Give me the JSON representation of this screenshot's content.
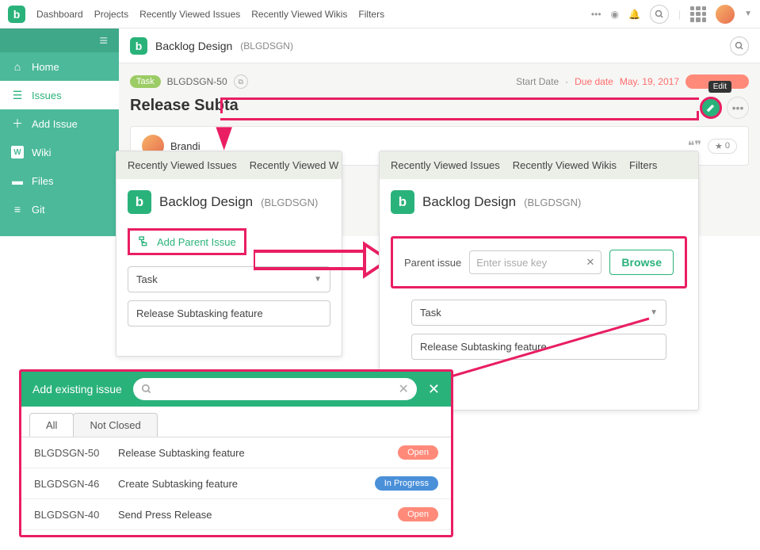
{
  "topnav": {
    "items": [
      "Dashboard",
      "Projects",
      "Recently Viewed Issues",
      "Recently Viewed Wikis",
      "Filters"
    ]
  },
  "sidebar": {
    "items": [
      {
        "label": "Home"
      },
      {
        "label": "Issues"
      },
      {
        "label": "Add Issue"
      },
      {
        "label": "Wiki"
      },
      {
        "label": "Files"
      },
      {
        "label": "Git"
      }
    ]
  },
  "project": {
    "name": "Backlog Design",
    "key": "(BLGDSGN)"
  },
  "issue": {
    "type_label": "Task",
    "key": "BLGDSGN-50",
    "title": "Release Subta",
    "start_label": "Start Date",
    "start_sep": "·",
    "due_label": "Due date",
    "due_value": "May. 19, 2017",
    "edit_tooltip": "Edit",
    "reporter": "Brandi",
    "star_count": "0"
  },
  "panelLeft": {
    "nav": [
      "Recently Viewed Issues",
      "Recently Viewed W"
    ],
    "add_parent_label": "Add Parent Issue",
    "type_value": "Task",
    "title_value": "Release Subtasking feature"
  },
  "panelRight": {
    "nav": [
      "Recently Viewed Issues",
      "Recently Viewed Wikis",
      "Filters"
    ],
    "parent_label": "Parent issue",
    "parent_placeholder": "Enter issue key",
    "browse_label": "Browse",
    "type_value": "Task",
    "title_value": "Release Subtasking feature"
  },
  "modal": {
    "title": "Add existing issue",
    "tabs": [
      "All",
      "Not Closed"
    ],
    "rows": [
      {
        "key": "BLGDSGN-50",
        "title": "Release Subtasking feature",
        "status": "Open",
        "cls": "st-open"
      },
      {
        "key": "BLGDSGN-46",
        "title": "Create Subtasking feature",
        "status": "In Progress",
        "cls": "st-prog"
      },
      {
        "key": "BLGDSGN-40",
        "title": "Send Press Release",
        "status": "Open",
        "cls": "st-open"
      }
    ]
  }
}
